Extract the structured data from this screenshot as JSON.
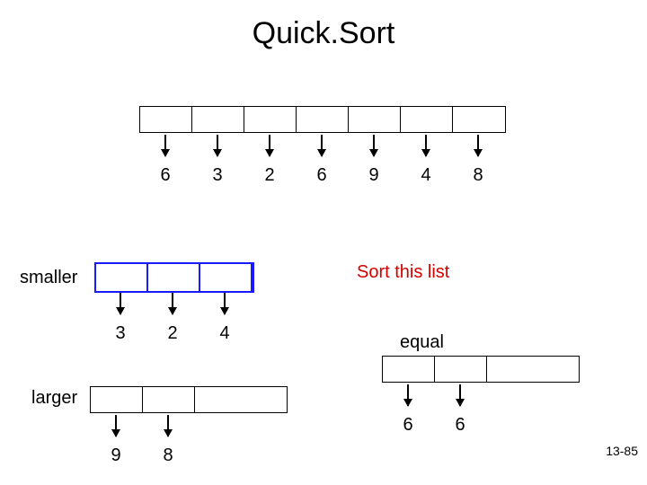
{
  "title": "Quick.Sort",
  "top_row": [
    "6",
    "3",
    "2",
    "6",
    "9",
    "4",
    "8"
  ],
  "label_smaller": "smaller",
  "label_sort": "Sort this list",
  "smaller_row": [
    "3",
    "2",
    "4"
  ],
  "label_equal": "equal",
  "equal_row": [
    "6",
    "6"
  ],
  "label_larger": "larger",
  "larger_row": [
    "9",
    "8"
  ],
  "slide_num": "13-85",
  "chart_data": {
    "type": "table",
    "title": "Quick.Sort partition step",
    "original": [
      6,
      3,
      2,
      6,
      9,
      4,
      8
    ],
    "pivot": 6,
    "smaller": [
      3,
      2,
      4
    ],
    "equal": [
      6,
      6
    ],
    "larger": [
      9,
      8
    ],
    "annotation": "Sort this list"
  }
}
